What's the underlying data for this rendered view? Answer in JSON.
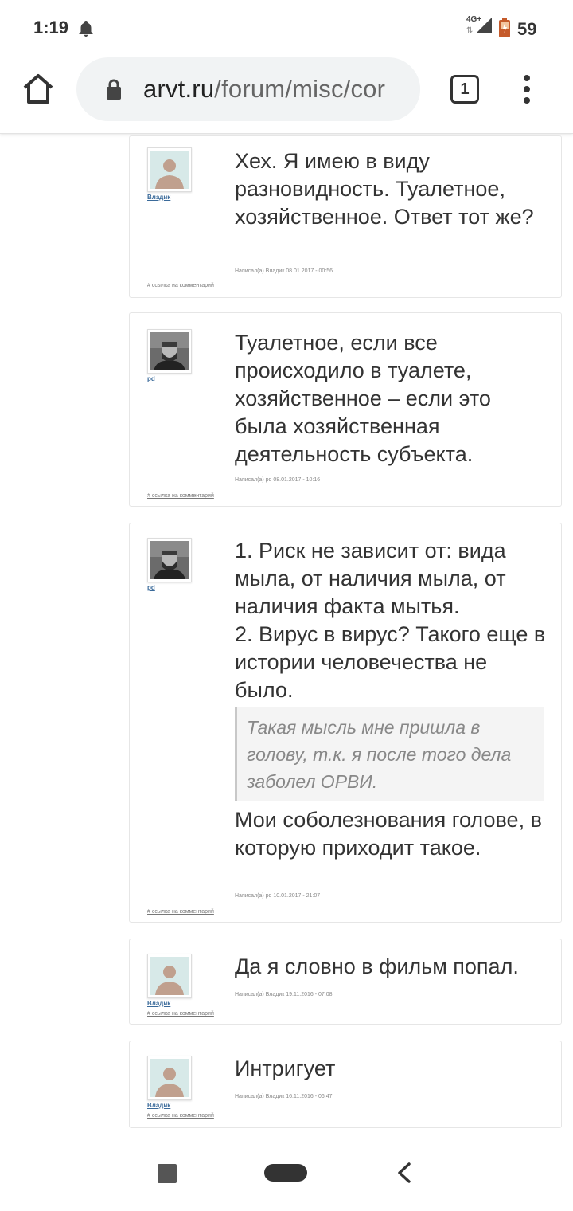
{
  "status_bar": {
    "time": "1:19",
    "network": "4G+",
    "battery_percent": "59",
    "icons": [
      "bell-icon",
      "data-arrows-icon",
      "signal-icon",
      "battery-icon"
    ]
  },
  "browser": {
    "url_domain": "arvt.ru",
    "url_path": "/forum/misc/cor",
    "tab_count": "1",
    "icons": [
      "home-icon",
      "lock-icon",
      "tabs-icon",
      "menu-icon"
    ]
  },
  "comments": [
    {
      "author": "Владик",
      "avatar": "default-avatar",
      "paragraphs_before": [
        "Хех. Я имею в виду разновидность. Туалетное, хозяйственное. Ответ тот же?"
      ],
      "quote": "",
      "paragraphs_after": [],
      "meta": "Написал(а) Владик 08.01.2017 - 00:56",
      "permalink": "# ссылка на комментарий"
    },
    {
      "author": "pd",
      "avatar": "photo-avatar",
      "paragraphs_before": [
        "Туалетное, если все происходило в туалете, хозяйственное – если это была хозяйственная деятельность субъекта."
      ],
      "quote": "",
      "paragraphs_after": [],
      "meta": "Написал(а) pd 08.01.2017 - 10:16",
      "permalink": "# ссылка на комментарий"
    },
    {
      "author": "pd",
      "avatar": "photo-avatar",
      "paragraphs_before": [
        "1. Риск не зависит от: вида мыла, от наличия мыла, от наличия факта мытья.",
        "2. Вирус в вирус? Такого еще в истории человечества не было."
      ],
      "quote": "Такая мысль мне пришла в голову, т.к. я после того дела заболел ОРВИ.",
      "paragraphs_after": [
        "Мои соболезнования голове, в которую приходит такое."
      ],
      "meta": "Написал(а) pd 10.01.2017 - 21:07",
      "permalink": "# ссылка на комментарий"
    },
    {
      "author": "Владик",
      "avatar": "default-avatar",
      "paragraphs_before": [
        "Да я словно в фильм попал."
      ],
      "quote": "",
      "paragraphs_after": [],
      "meta": "Написал(а) Владик 19.11.2016 - 07:08",
      "permalink": "# ссылка на комментарий"
    },
    {
      "author": "Владик",
      "avatar": "default-avatar",
      "paragraphs_before": [
        "Интригует"
      ],
      "quote": "",
      "paragraphs_after": [],
      "meta": "Написал(а) Владик 16.11.2016 - 06:47",
      "permalink": "# ссылка на комментарий"
    }
  ],
  "nav_bar": {
    "icons": [
      "recents-icon",
      "home-pill-icon",
      "back-icon"
    ]
  }
}
